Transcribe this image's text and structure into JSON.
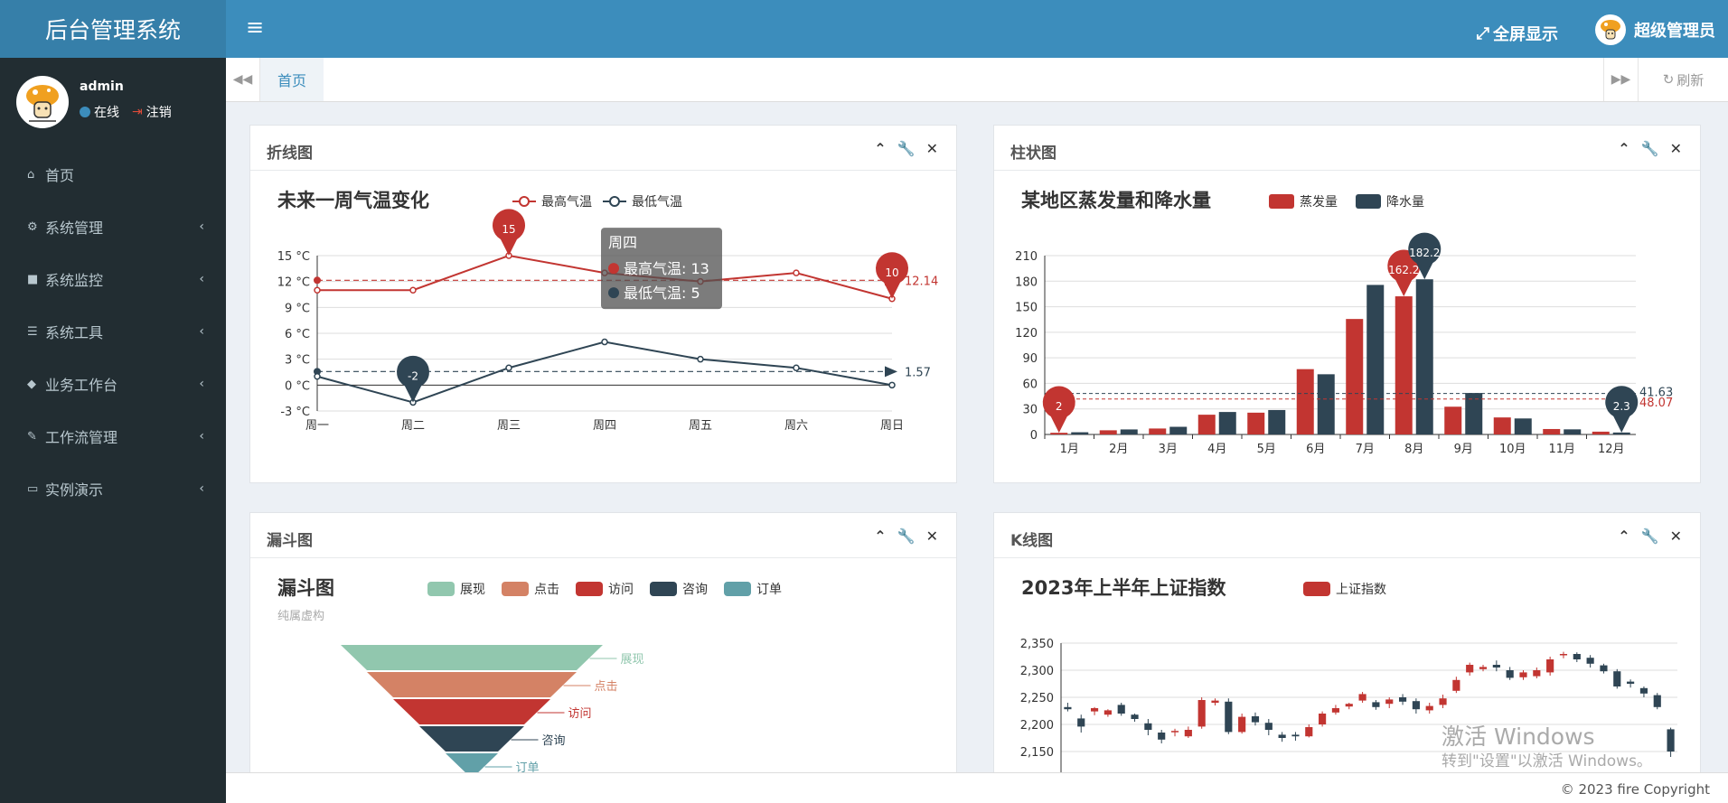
{
  "app": {
    "title": "后台管理系统",
    "fullscreen_label": "全屏显示",
    "user_label": "超级管理员",
    "footer": "© 2023 fire Copyright"
  },
  "sidebar": {
    "username": "admin",
    "status": "在线",
    "logout": "注销",
    "items": [
      {
        "label": "首页",
        "icon": "home-icon"
      },
      {
        "label": "系统管理",
        "icon": "gear-icon"
      },
      {
        "label": "系统监控",
        "icon": "video-icon"
      },
      {
        "label": "系统工具",
        "icon": "server-icon"
      },
      {
        "label": "业务工作台",
        "icon": "cube-icon"
      },
      {
        "label": "工作流管理",
        "icon": "gavel-icon"
      },
      {
        "label": "实例演示",
        "icon": "desktop-icon"
      }
    ]
  },
  "tabs": {
    "home": "首页",
    "refresh": "刷新"
  },
  "panels": {
    "line": "折线图",
    "bar": "柱状图",
    "funnel": "漏斗图",
    "kline": "K线图"
  },
  "watermark": {
    "line1": "激活 Windows",
    "line2": "转到\"设置\"以激活 Windows。"
  },
  "colors": {
    "header": "#3c8dbc",
    "sidebar": "#222d32",
    "red": "#c23531",
    "navy": "#2f4554"
  },
  "chart_data": [
    {
      "type": "line",
      "title": "未来一周气温变化",
      "categories": [
        "周一",
        "周二",
        "周三",
        "周四",
        "周五",
        "周六",
        "周日"
      ],
      "series": [
        {
          "name": "最高气温",
          "values": [
            11,
            11,
            15,
            13,
            12,
            13,
            10
          ]
        },
        {
          "name": "最低气温",
          "values": [
            1,
            -2,
            2,
            5,
            3,
            2,
            0
          ]
        }
      ],
      "ylim": [
        -3,
        15
      ],
      "yticks": [
        "15 °C",
        "12 °C",
        "9 °C",
        "6 °C",
        "3 °C",
        "0 °C",
        "-3 °C"
      ],
      "max_labels": [
        "15",
        "-2"
      ],
      "min_labels": [
        "10"
      ],
      "avg_labels": [
        "12.14",
        "1.57"
      ],
      "tooltip": {
        "title": "周四",
        "lines": [
          "最高气温: 13",
          "最低气温: 5"
        ]
      }
    },
    {
      "type": "bar",
      "title": "某地区蒸发量和降水量",
      "categories": [
        "1月",
        "2月",
        "3月",
        "4月",
        "5月",
        "6月",
        "7月",
        "8月",
        "9月",
        "10月",
        "11月",
        "12月"
      ],
      "series": [
        {
          "name": "蒸发量",
          "values": [
            2,
            4.9,
            7,
            23.2,
            25.6,
            76.7,
            135.6,
            162.2,
            32.6,
            20,
            6.4,
            3.3
          ]
        },
        {
          "name": "降水量",
          "values": [
            2.6,
            5.9,
            9,
            26.4,
            28.7,
            70.7,
            175.6,
            182.2,
            48.7,
            18.8,
            6,
            2.3
          ]
        }
      ],
      "ylim": [
        0,
        210
      ],
      "yticks": [
        "210",
        "180",
        "150",
        "120",
        "90",
        "60",
        "30",
        "0"
      ],
      "point_labels": [
        "162.2",
        "182.2",
        "2",
        "2.3"
      ],
      "avg_labels": [
        "48.07",
        "41.63"
      ]
    },
    {
      "type": "funnel",
      "title": "漏斗图",
      "subtitle": "纯属虚构",
      "categories": [
        "展现",
        "点击",
        "访问",
        "咨询",
        "订单"
      ],
      "values": [
        100,
        80,
        60,
        40,
        20
      ]
    },
    {
      "type": "candlestick",
      "title": "2023年上半年上证指数",
      "series": [
        {
          "name": "上证指数"
        }
      ],
      "ylim": [
        2130,
        2350
      ],
      "yticks": [
        "2,350",
        "2,300",
        "2,250",
        "2,200",
        "2,150"
      ],
      "ohlc": [
        [
          2232,
          2228,
          2224,
          2240
        ],
        [
          2211,
          2196,
          2185,
          2218
        ],
        [
          2224,
          2230,
          2217,
          2232
        ],
        [
          2218,
          2226,
          2214,
          2228
        ],
        [
          2236,
          2220,
          2216,
          2240
        ],
        [
          2218,
          2210,
          2205,
          2220
        ],
        [
          2202,
          2190,
          2180,
          2210
        ],
        [
          2185,
          2172,
          2165,
          2190
        ],
        [
          2186,
          2188,
          2178,
          2192
        ],
        [
          2178,
          2190,
          2175,
          2196
        ],
        [
          2196,
          2245,
          2192,
          2250
        ],
        [
          2240,
          2244,
          2235,
          2248
        ],
        [
          2242,
          2186,
          2182,
          2248
        ],
        [
          2186,
          2214,
          2183,
          2220
        ],
        [
          2215,
          2204,
          2198,
          2222
        ],
        [
          2203,
          2190,
          2180,
          2210
        ],
        [
          2181,
          2175,
          2168,
          2186
        ],
        [
          2181,
          2178,
          2170,
          2186
        ],
        [
          2178,
          2195,
          2176,
          2200
        ],
        [
          2200,
          2220,
          2196,
          2224
        ],
        [
          2222,
          2230,
          2218,
          2236
        ],
        [
          2233,
          2238,
          2228,
          2240
        ],
        [
          2244,
          2256,
          2240,
          2260
        ],
        [
          2241,
          2232,
          2227,
          2245
        ],
        [
          2238,
          2246,
          2230,
          2250
        ],
        [
          2250,
          2242,
          2236,
          2256
        ],
        [
          2243,
          2228,
          2220,
          2248
        ],
        [
          2226,
          2234,
          2220,
          2240
        ],
        [
          2236,
          2248,
          2230,
          2255
        ],
        [
          2262,
          2282,
          2258,
          2288
        ],
        [
          2296,
          2310,
          2290,
          2314
        ],
        [
          2302,
          2306,
          2298,
          2310
        ],
        [
          2310,
          2305,
          2298,
          2318
        ],
        [
          2300,
          2286,
          2282,
          2306
        ],
        [
          2287,
          2296,
          2282,
          2300
        ],
        [
          2289,
          2300,
          2285,
          2305
        ],
        [
          2296,
          2320,
          2290,
          2325
        ],
        [
          2329,
          2330,
          2322,
          2334
        ],
        [
          2330,
          2320,
          2315,
          2333
        ],
        [
          2323,
          2312,
          2305,
          2328
        ],
        [
          2309,
          2298,
          2294,
          2312
        ],
        [
          2298,
          2270,
          2266,
          2302
        ],
        [
          2279,
          2275,
          2268,
          2283
        ],
        [
          2267,
          2257,
          2250,
          2270
        ],
        [
          2254,
          2232,
          2228,
          2258
        ],
        [
          2191,
          2150,
          2140,
          2194
        ]
      ]
    }
  ]
}
